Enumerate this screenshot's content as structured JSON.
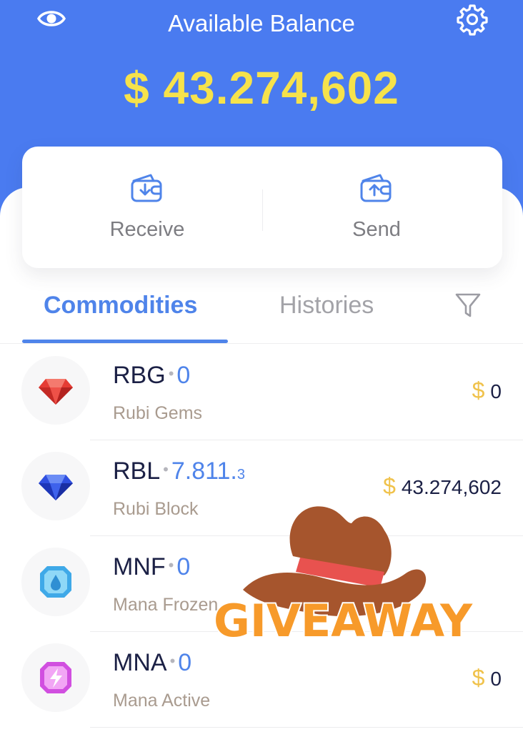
{
  "header": {
    "title": "Available Balance",
    "balance": "$ 43.274,602",
    "eye_icon": "eye-icon",
    "settings_icon": "gear-icon"
  },
  "actions": [
    {
      "label": "Receive",
      "icon": "wallet-receive-icon"
    },
    {
      "label": "Send",
      "icon": "wallet-send-icon"
    }
  ],
  "tabs": {
    "items": [
      {
        "label": "Commodities",
        "active": true
      },
      {
        "label": "Histories",
        "active": false
      }
    ],
    "filter_icon": "filter-icon"
  },
  "assets": [
    {
      "symbol": "RBG",
      "amount": "0",
      "amount_small": "",
      "name": "Rubi Gems",
      "currency": "$",
      "usd": "0",
      "icon": "red-gem-icon"
    },
    {
      "symbol": "RBL",
      "amount": "7.811.",
      "amount_small": "3",
      "name": "Rubi Block",
      "currency": "$",
      "usd": "43.274,602",
      "icon": "blue-gem-icon"
    },
    {
      "symbol": "MNF",
      "amount": "0",
      "amount_small": "",
      "name": "Mana Frozen",
      "currency": "",
      "usd": "",
      "icon": "frozen-mana-icon"
    },
    {
      "symbol": "MNA",
      "amount": "0",
      "amount_small": "",
      "name": "Mana Active",
      "currency": "$",
      "usd": "0",
      "icon": "active-mana-icon"
    }
  ],
  "sticker": {
    "text": "GIVEAWAY",
    "icon": "cowboy-hat-icon"
  },
  "colors": {
    "header_blue": "#4a7bf0",
    "balance_yellow": "#f6e24b",
    "accent_blue": "#4f84ea",
    "dollar_gold": "#f0c24b",
    "sticker_orange": "#f79a2a"
  }
}
